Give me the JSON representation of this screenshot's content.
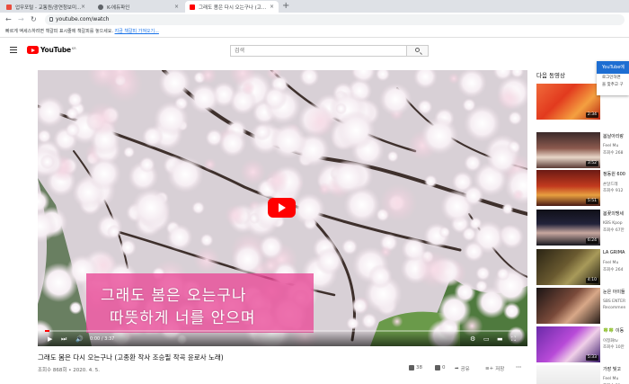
{
  "browser": {
    "tabs": [
      {
        "label": "업무포털 - 교통원/광연청보미…",
        "fav_color": "#e94c3d"
      },
      {
        "label": "K-에듀파인",
        "fav_color": "#5f6368"
      },
      {
        "label": "그래도 봄은 다시 오는구나 (고…",
        "fav_color": "#ff0000"
      }
    ],
    "new_tab": "+",
    "tab_close": "×",
    "address": "youtube.com/watch",
    "bookmark_notice": "빠르게 액세스하려면 책갈피 표시줄에 책갈피를 놓으세요.",
    "bookmark_link": "지금 책갈피 가져오기..."
  },
  "youtube": {
    "logo_text": "YouTube",
    "logo_region": "KR",
    "search_placeholder": "검색"
  },
  "player": {
    "caption_line1": "그래도 봄은 오는구나",
    "caption_line2": "따뜻하게 너를 안으며",
    "time": "0:00 / 3:37",
    "progress": 0.01
  },
  "video": {
    "title": "그래도 봄은 다시 오는구나 (고종환 작사 조승필 작곡 윤로사 노래)",
    "views_date": "조회수 868회 • 2020. 4. 5.",
    "likes": "38",
    "dislikes": "0",
    "share": "공유",
    "save": "저장",
    "more": "···"
  },
  "sidebar": {
    "heading": "다음 동영상",
    "items": [
      {
        "title": "",
        "channel": "",
        "views": "",
        "duration": "2:34",
        "thumb": "linear-gradient(135deg,#f06a3a,#e23a1e 40%,#f4a040 70%,#b72612)"
      },
      {
        "title": "봄날아리랑",
        "channel": "Feel Mu",
        "views": "조회수 268",
        "duration": "3:52",
        "thumb": "linear-gradient(180deg,#3a2a2a,#8c5a4e 45%,#e8d6c8 70%,#5a3a34)"
      },
      {
        "title": "정동원 600",
        "channel": "손달드레",
        "views": "조회수 912",
        "duration": "5:51",
        "thumb": "linear-gradient(180deg,#6b1a14,#c23a1e 45%,#e8a040 70%,#4a1a14)"
      },
      {
        "title": "봄꽃의맹세",
        "channel": "KBS Kpop",
        "views": "조회수 67만",
        "duration": "6:24",
        "thumb": "linear-gradient(180deg,#101018,#22223a 40%,#c8a8a0 65%,#181820)"
      },
      {
        "title": "LA GRIMA",
        "channel": "Feel Mu",
        "views": "조회수 264",
        "duration": "4:10",
        "thumb": "linear-gradient(135deg,#2a2414,#6a5a30 45%,#a89a5a 65%,#1e1a10)"
      },
      {
        "title": "눈은 아이들",
        "channel": "SBS ENTER",
        "views": "Recommen",
        "duration": "",
        "thumb": "linear-gradient(135deg,#1a1414,#7a4a3a 45%,#d8a888 65%,#241a16)"
      },
      {
        "title": "🍀🍀 이동",
        "channel": "이정화tv",
        "views": "조회수 10만",
        "duration": "5:33",
        "thumb": "linear-gradient(135deg,#6a2aa8,#b84ad8 45%,#f0d0e8 65%,#3a1a6a)"
      },
      {
        "title": "가장 빛고",
        "channel": "Feel Mu",
        "views": "조회수 51",
        "duration": "",
        "thumb": "linear-gradient(180deg,#f8f8f8,#e8e8e8 60%,#d0d0d0)"
      }
    ]
  },
  "signin_popup": {
    "title": "YouTube에",
    "line1": "로그인하면",
    "line2": "을 맞추고 구"
  }
}
